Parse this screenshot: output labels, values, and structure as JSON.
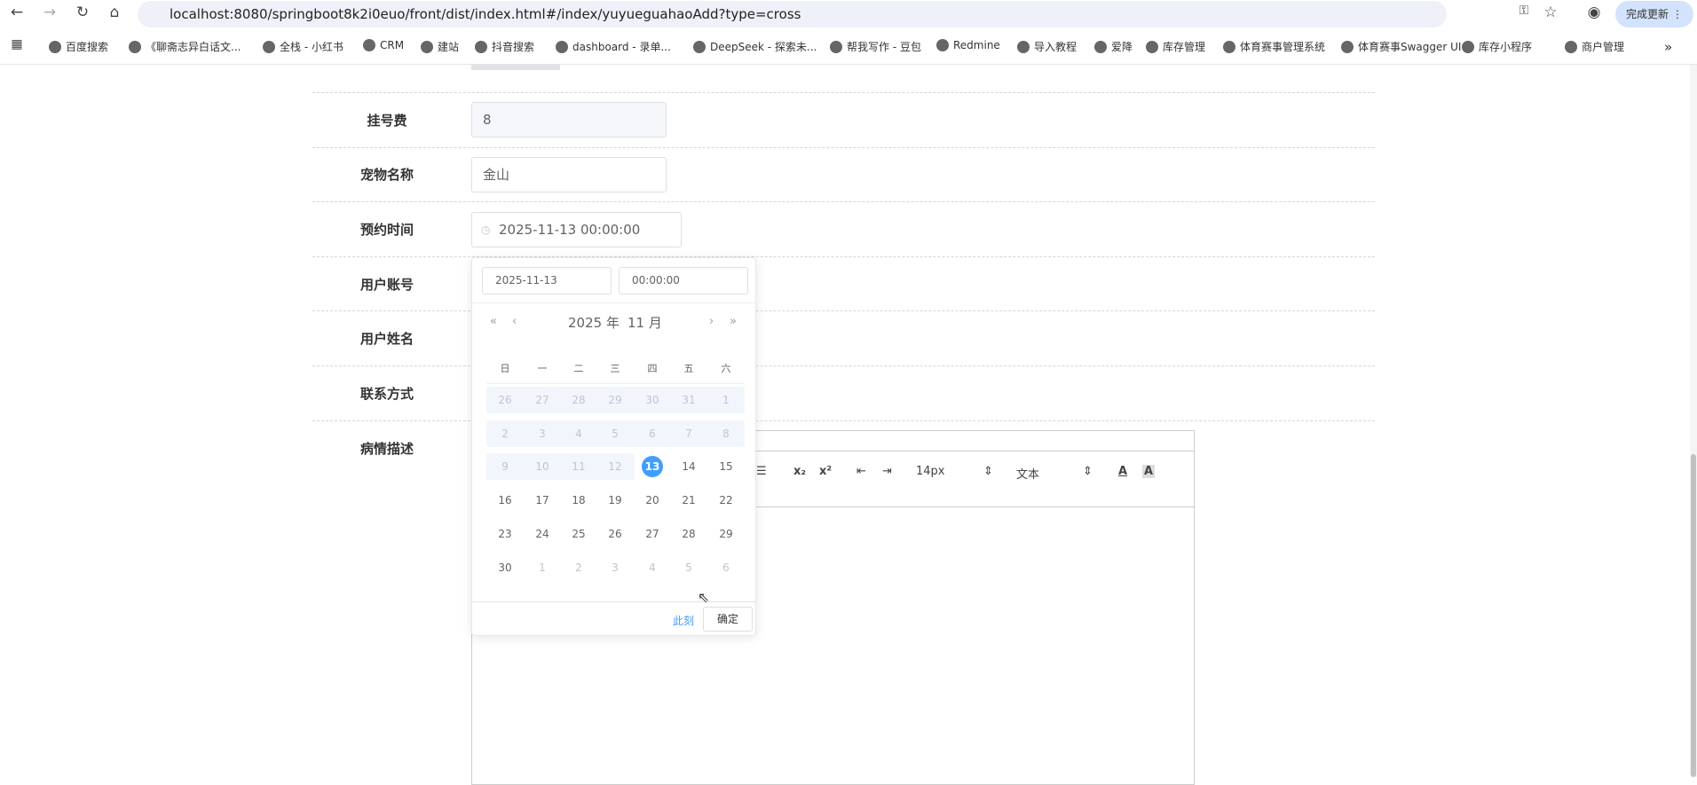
{
  "browser": {
    "url": "localhost:8080/springboot8k2i0euo/front/dist/index.html#/index/yuyueguahaoAdd?type=cross",
    "update_label": "完成更新",
    "bookmarks": [
      "百度搜索",
      "《聊斋志异白话文...",
      "全栈 - 小红书",
      "CRM",
      "建站",
      "抖音搜索",
      "dashboard - 录单...",
      "DeepSeek - 探索未...",
      "帮我写作 - 豆包",
      "Redmine",
      "导入教程",
      "爱降",
      "库存管理",
      "体育赛事管理系统",
      "体育赛事Swagger UI",
      "库存小程序",
      "商户管理"
    ],
    "more": "»"
  },
  "form": {
    "fee": {
      "label": "挂号费",
      "value": "8"
    },
    "pet": {
      "label": "宠物名称",
      "value": "金山"
    },
    "time": {
      "label": "预约时间",
      "value": "2025-11-13 00:00:00"
    },
    "account": {
      "label": "用户账号"
    },
    "name": {
      "label": "用户姓名"
    },
    "phone": {
      "label": "联系方式"
    },
    "desc": {
      "label": "病情描述"
    }
  },
  "editor": {
    "list_icon": "☰",
    "sub": "x₂",
    "sup": "x²",
    "indent_out": "⇤",
    "indent_in": "⇥",
    "size": "14px",
    "size_arrow": "⇕",
    "font": "文本",
    "font_arrow": "⇕",
    "color": "A",
    "bg": "A"
  },
  "picker": {
    "date": "2025-11-13",
    "time": "00:00:00",
    "prev_year": "«",
    "prev_month": "‹",
    "next_month": "›",
    "next_year": "»",
    "year": "2025 年",
    "month": "11 月",
    "weekdays": [
      "日",
      "一",
      "二",
      "三",
      "四",
      "五",
      "六"
    ],
    "weeks": [
      [
        "26",
        "27",
        "28",
        "29",
        "30",
        "31",
        "1"
      ],
      [
        "2",
        "3",
        "4",
        "5",
        "6",
        "7",
        "8"
      ],
      [
        "9",
        "10",
        "11",
        "12",
        "13",
        "14",
        "15"
      ],
      [
        "16",
        "17",
        "18",
        "19",
        "20",
        "21",
        "22"
      ],
      [
        "23",
        "24",
        "25",
        "26",
        "27",
        "28",
        "29"
      ],
      [
        "30",
        "1",
        "2",
        "3",
        "4",
        "5",
        "6"
      ]
    ],
    "selected": "13",
    "now": "此刻",
    "confirm": "确定"
  }
}
